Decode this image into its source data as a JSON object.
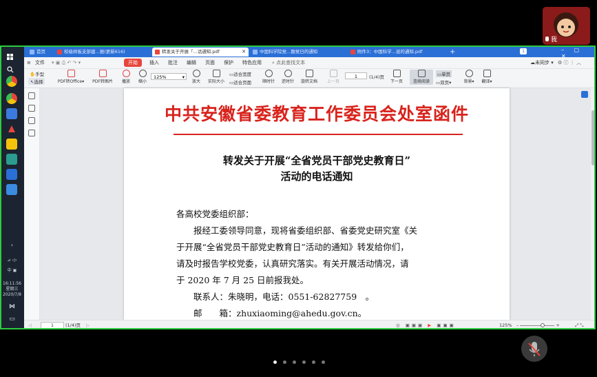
{
  "meeting": {
    "participant_name": "我",
    "page_dots": 6,
    "active_dot": 0,
    "colors": {
      "frame_green": "#2ecc40",
      "background": "#000000"
    }
  },
  "taskbar": {
    "time": "16:11:56",
    "weekday": "星期三",
    "date": "2020/7/8",
    "ime": "中",
    "icons": [
      "windows-start-icon",
      "search-icon",
      "chrome-icon",
      "chrome-icon-2",
      "app-blue-icon",
      "app-red-icon",
      "folder-icon",
      "app-teal-icon",
      "app-tech-icon",
      "app-cloud-icon"
    ]
  },
  "browser": {
    "tabs": [
      {
        "label": "首页",
        "active": false,
        "icon_color": "#2a6fd6"
      },
      {
        "label": "校级样板支部建...据(更新616)",
        "active": false,
        "icon_color": "#e8453c"
      },
      {
        "label": "转发关于开展「...话通知.pdf",
        "active": true,
        "icon_color": "#e8453c"
      },
      {
        "label": "中国科学院党...题党日的通知",
        "active": false,
        "icon_color": "#2a6fd6"
      },
      {
        "label": "附件3：中国科学...说的通知.pdf",
        "active": false,
        "icon_color": "#e8453c"
      }
    ],
    "new_tab": "+",
    "tab_count_badge": "1"
  },
  "menu": {
    "file": "文件",
    "items": [
      "开始",
      "插入",
      "批注",
      "编辑",
      "页面",
      "保护",
      "特色应用"
    ],
    "search_placeholder": "点此查找文本",
    "sync_status": "未同步"
  },
  "toolbar": {
    "hand": "手型",
    "select": "选择",
    "pdf_to_office": "PDF转Office",
    "pdf_to_image": "PDF转图片",
    "play": "播放",
    "zoom_out": "缩小",
    "zoom_value": "125%",
    "zoom_in": "放大",
    "actual_size": "实际大小",
    "fit_width": "适合宽度",
    "fit_page": "适合页面",
    "rotate_left": "顺时针",
    "rotate_right": "逆时针",
    "rotate_doc": "旋转文档",
    "prev_page": "上一页",
    "page_input": "1",
    "page_total": "(1/4)页",
    "next_page": "下一页",
    "continuous": "连续阅读",
    "single_page": "单页",
    "double_page": "双页",
    "background": "背景",
    "translate": "翻译"
  },
  "document": {
    "header": "中共安徽省委教育工作委员会处室函件",
    "title_line1": "转发关于开展“全省党员干部党史教育日”",
    "title_line2": "活动的电话通知",
    "salutation": "各高校党委组织部：",
    "para1_line1": "　　报经工委领导同意，现将省委组织部、省委党史研究室《关",
    "para1_line2": "于开展“全省党员干部党史教育日”活动的通知》转发给你们，",
    "para1_line3": "请及时报告学校党委，认真研究落实。有关开展活动情况，请",
    "para1_line4": "于 2020 年 7 月 25 日前报我处。",
    "contact": "　　联系人：朱晓明，电话：0551-62827759　。",
    "email": "　　邮　　箱：zhuxiaoming@ahedu.gov.cn。"
  },
  "statusbar": {
    "page_input": "1",
    "page_total": "(1/4)页",
    "zoom": "125%"
  }
}
